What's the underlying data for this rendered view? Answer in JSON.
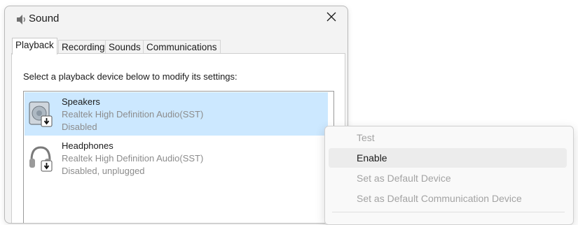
{
  "window": {
    "title": "Sound",
    "icon": "speaker-icon",
    "close_icon": "close-icon"
  },
  "tabs": [
    {
      "label": "Playback",
      "active": true
    },
    {
      "label": "Recording",
      "active": false
    },
    {
      "label": "Sounds",
      "active": false
    },
    {
      "label": "Communications",
      "active": false
    }
  ],
  "playback": {
    "instruction": "Select a playback device below to modify its settings:",
    "devices": [
      {
        "name": "Speakers",
        "driver": "Realtek High Definition Audio(SST)",
        "status": "Disabled",
        "icon": "speakers-icon",
        "selected": true
      },
      {
        "name": "Headphones",
        "driver": "Realtek High Definition Audio(SST)",
        "status": "Disabled, unplugged",
        "icon": "headphones-icon",
        "selected": false
      }
    ]
  },
  "context_menu": {
    "items": [
      {
        "label": "Test",
        "enabled": false
      },
      {
        "label": "Enable",
        "enabled": true,
        "hovered": true
      },
      {
        "label": "Set as Default Device",
        "enabled": false
      },
      {
        "label": "Set as Default Communication Device",
        "enabled": false
      }
    ]
  },
  "colors": {
    "selection": "#cce8ff",
    "disabled_text": "#a3a3a3",
    "secondary_text": "#8c8c8c"
  }
}
